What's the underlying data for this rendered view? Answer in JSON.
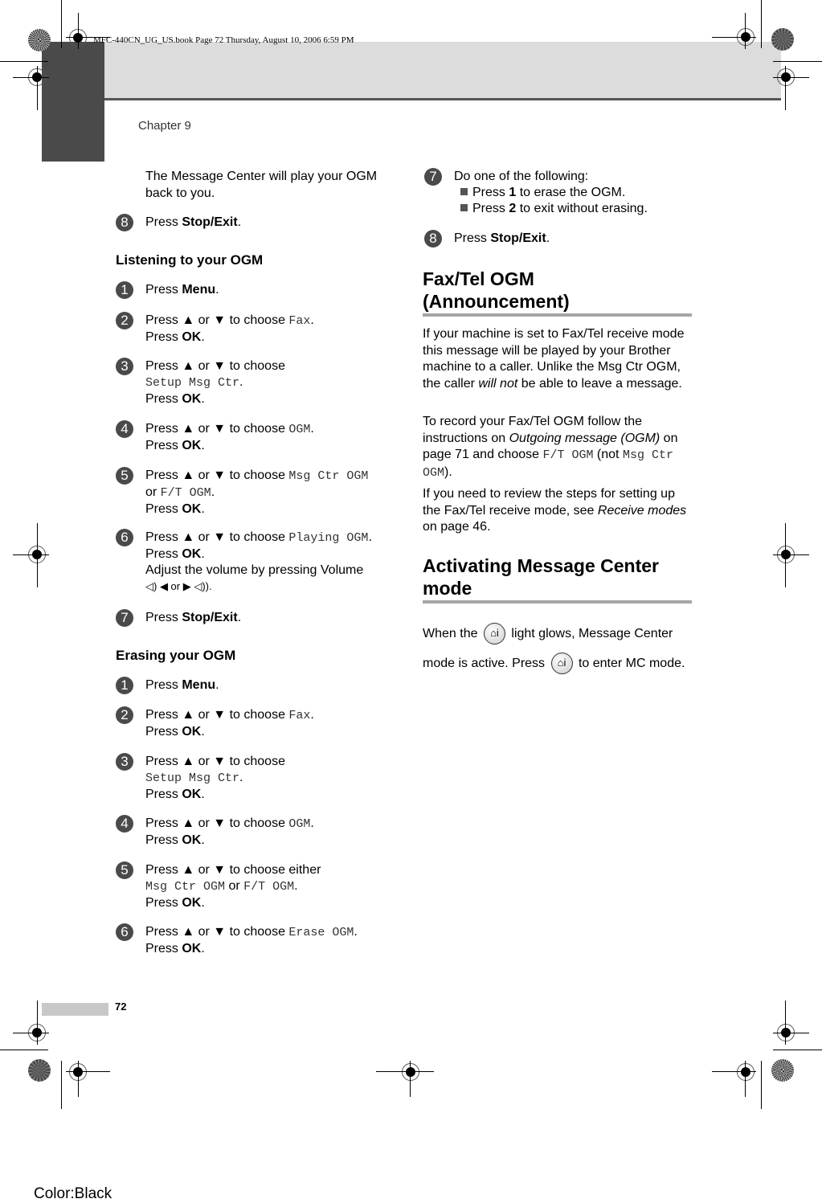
{
  "header": {
    "book_info": "MFC-440CN_UG_US.book  Page 72  Thursday, August 10, 2006  6:59 PM",
    "chapter": "Chapter 9"
  },
  "left_column": {
    "intro": "The Message Center will play your OGM back to you.",
    "step8": {
      "num": "8",
      "pre": "Press ",
      "bold": "Stop/Exit",
      "post": "."
    },
    "listening": {
      "heading": "Listening to your OGM",
      "steps": [
        {
          "num": "1",
          "l1_pre": "Press ",
          "l1_bold": "Menu",
          "l1_post": "."
        },
        {
          "num": "2",
          "l1_pre": "Press ▲ or ▼ to choose ",
          "l1_mono": "Fax",
          "l1_post": ".",
          "l2_pre": "Press ",
          "l2_bold": "OK",
          "l2_post": "."
        },
        {
          "num": "3",
          "l1_pre": "Press ▲ or ▼ to choose",
          "l2_mono": "Setup Msg Ctr",
          "l2_post": ".",
          "l3_pre": "Press ",
          "l3_bold": "OK",
          "l3_post": "."
        },
        {
          "num": "4",
          "l1_pre": "Press ▲ or ▼ to choose ",
          "l1_mono": "OGM",
          "l1_post": ".",
          "l2_pre": "Press ",
          "l2_bold": "OK",
          "l2_post": "."
        },
        {
          "num": "5",
          "l1_pre": "Press ▲ or ▼ to choose ",
          "l1_mono": "Msg Ctr OGM",
          "l2_pre": "or ",
          "l2_mono": "F/T OGM",
          "l2_post": ".",
          "l3_pre": "Press ",
          "l3_bold": "OK",
          "l3_post": "."
        },
        {
          "num": "6",
          "l1_pre": "Press ▲ or ▼ to choose ",
          "l1_mono": "Playing OGM",
          "l1_post": ".",
          "l2_pre": "Press ",
          "l2_bold": "OK",
          "l2_post": ".",
          "l3": "Adjust the volume by pressing Volume",
          "l4": "◁) ◀ or ▶ ◁))."
        },
        {
          "num": "7",
          "l1_pre": "Press ",
          "l1_bold": "Stop/Exit",
          "l1_post": "."
        }
      ]
    },
    "erasing": {
      "heading": "Erasing your OGM",
      "steps": [
        {
          "num": "1",
          "l1_pre": "Press ",
          "l1_bold": "Menu",
          "l1_post": "."
        },
        {
          "num": "2",
          "l1_pre": "Press ▲ or ▼ to choose ",
          "l1_mono": "Fax",
          "l1_post": ".",
          "l2_pre": "Press ",
          "l2_bold": "OK",
          "l2_post": "."
        },
        {
          "num": "3",
          "l1_pre": "Press ▲ or ▼ to choose",
          "l2_mono": "Setup Msg Ctr",
          "l2_post": ".",
          "l3_pre": "Press ",
          "l3_bold": "OK",
          "l3_post": "."
        },
        {
          "num": "4",
          "l1_pre": "Press ▲ or ▼ to choose ",
          "l1_mono": "OGM",
          "l1_post": ".",
          "l2_pre": "Press ",
          "l2_bold": "OK",
          "l2_post": "."
        },
        {
          "num": "5",
          "l1_pre": "Press ▲ or ▼ to choose either",
          "l2_mono": "Msg Ctr OGM",
          "l2_mid": " or ",
          "l2_mono2": "F/T OGM",
          "l2_post": ".",
          "l3_pre": "Press ",
          "l3_bold": "OK",
          "l3_post": "."
        },
        {
          "num": "6",
          "l1_pre": "Press ▲ or ▼ to choose ",
          "l1_mono": "Erase OGM",
          "l1_post": ".",
          "l2_pre": "Press ",
          "l2_bold": "OK",
          "l2_post": "."
        }
      ]
    }
  },
  "right_column": {
    "step7": {
      "num": "7",
      "text": "Do one of the following:",
      "bullets": [
        {
          "pre": "Press ",
          "bold": "1",
          "post": " to erase the OGM."
        },
        {
          "pre": "Press ",
          "bold": "2",
          "post": " to exit without erasing."
        }
      ]
    },
    "step8": {
      "num": "8",
      "pre": "Press ",
      "bold": "Stop/Exit",
      "post": "."
    },
    "faxtel": {
      "heading_l1": "Fax/Tel OGM",
      "heading_l2": "(Announcement)",
      "p1_pre": "If your machine is set to Fax/Tel receive mode this message will be played by your Brother machine to a caller. Unlike the Msg Ctr OGM, the caller ",
      "p1_italic": "will not",
      "p1_post": " be able to leave a message.",
      "p2_pre": "To record your Fax/Tel OGM follow the instructions on ",
      "p2_italic": "Outgoing message (OGM)",
      "p2_mid": " on page 71 and choose ",
      "p2_mono": "F/T OGM",
      "p2_mid2": " (not ",
      "p2_mono2": "Msg Ctr OGM",
      "p2_post": ").",
      "p3_pre": "If you need to review the steps for setting up the Fax/Tel receive mode, see ",
      "p3_italic": "Receive modes",
      "p3_post": " on page 46."
    },
    "activating": {
      "heading_l1": "Activating Message Center",
      "heading_l2": "mode",
      "p_pre": "When the ",
      "p_mid": " light glows, Message Center mode is active. Press ",
      "p_post": " to enter MC mode.",
      "icon_glyph": "⌂i"
    }
  },
  "footer": {
    "page_number": "72",
    "color_label": "Color:Black"
  }
}
